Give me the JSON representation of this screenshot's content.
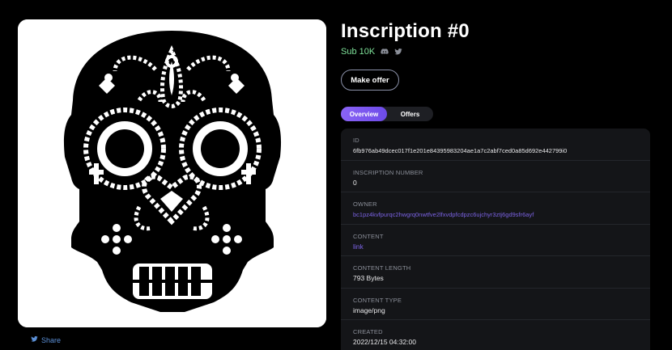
{
  "inscription": {
    "title": "Inscription #0",
    "collection": "Sub 10K"
  },
  "actions": {
    "make_offer_label": "Make offer",
    "share_label": "Share"
  },
  "tabs": [
    {
      "label": "Overview",
      "active": true
    },
    {
      "label": "Offers",
      "active": false
    }
  ],
  "details": [
    {
      "label": "ID",
      "value": "6fb976ab49dcec017f1e201e84395983204ae1a7c2abf7ced0a85d692e442799i0"
    },
    {
      "label": "INSCRIPTION NUMBER",
      "value": "0"
    },
    {
      "label": "OWNER",
      "value": "bc1pz4kvfpurqc2hwgrq0nwtfve2lfxvdpfcdpzc6ujchyr3ztj6gd9sfr6ayf"
    },
    {
      "label": "CONTENT",
      "value": "link"
    },
    {
      "label": "CONTENT LENGTH",
      "value": "793 Bytes"
    },
    {
      "label": "CONTENT TYPE",
      "value": "image/png"
    },
    {
      "label": "CREATED",
      "value": "2022/12/15 04:32:00"
    }
  ],
  "icons": {
    "discord": "discord-icon",
    "twitter": "twitter-icon",
    "share": "twitter-share-icon"
  },
  "colors": {
    "accent": "#7c63e6",
    "collection": "#7fe39a",
    "panel": "#141518",
    "background": "#000000"
  }
}
